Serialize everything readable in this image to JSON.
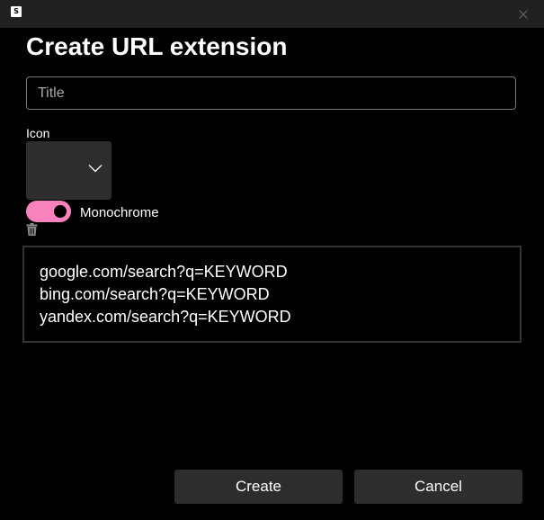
{
  "window": {
    "app_icon_letter": "S",
    "close_icon": "close-icon"
  },
  "dialog": {
    "heading": "Create URL extension",
    "title_field": {
      "value": "",
      "placeholder": "Title"
    },
    "icon_section": {
      "label": "Icon",
      "selected_value": "",
      "dropdown_icon": "chevron-down-icon"
    },
    "monochrome": {
      "label": "Monochrome",
      "checked": true,
      "accent_color": "#f882bd"
    },
    "delete_icon": "trash-icon",
    "urls": [
      "google.com/search?q=KEYWORD",
      "bing.com/search?q=KEYWORD",
      "yandex.com/search?q=KEYWORD"
    ],
    "buttons": {
      "create": "Create",
      "cancel": "Cancel"
    }
  }
}
